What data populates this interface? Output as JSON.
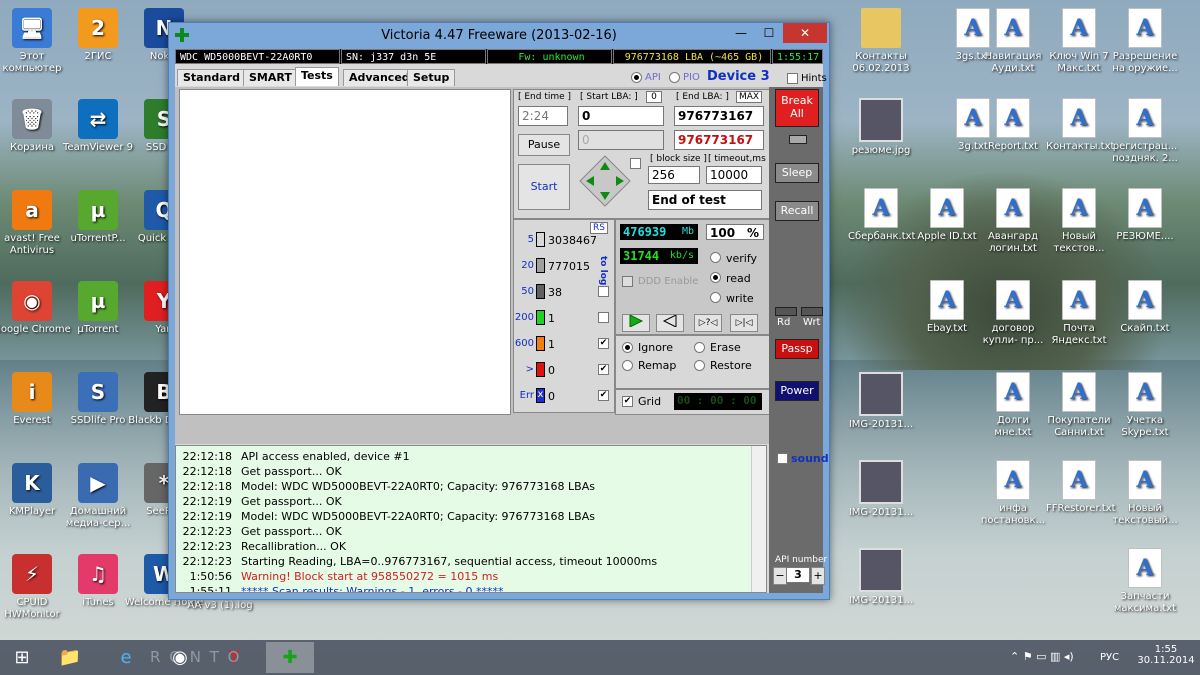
{
  "window": {
    "title": "Victoria 4.47  Freeware (2013-02-16)",
    "minimize": "—",
    "maximize": "☐",
    "close": "✕"
  },
  "infobar": {
    "model": "WDC WD5000BEVT-22A0RT0",
    "serial": "SN: j337   d3n 5E",
    "firmware": "Fw: unknown",
    "lba": "976773168 LBA (~465 GB)",
    "clock": "1:55:17"
  },
  "tabs": [
    "Standard",
    "SMART",
    "Tests",
    "Advanced",
    "Setup"
  ],
  "interface": {
    "api": "API",
    "pio": "PIO",
    "device": "Device 3",
    "hints": "Hints"
  },
  "test": {
    "end_time_label": "[ End time ]",
    "end_time_value": "2:24",
    "start_lba_label": "[ Start LBA: ]",
    "start_lba_small": "0",
    "start_lba_value": "0",
    "end_lba_label": "[ End LBA: ]",
    "end_lba_max": "MAX",
    "end_lba_value": "976773167",
    "current_lba_value": "0",
    "end_lba_value2": "976773167",
    "pause": "Pause",
    "start": "Start",
    "block_size_label": "[ block size ]",
    "block_size_value": "256",
    "timeout_label": "[ timeout,ms ]",
    "timeout_value": "10000",
    "end_action": "End of test"
  },
  "stats": {
    "rs": "RS",
    "to_log": "to log:",
    "rows": [
      {
        "label": "5",
        "color": "#d8d8d8",
        "count": "3038467",
        "checked": ""
      },
      {
        "label": "20",
        "color": "#a0a0a0",
        "count": "777015",
        "checked": ""
      },
      {
        "label": "50",
        "color": "#606060",
        "count": "38",
        "checked": ""
      },
      {
        "label": "200",
        "color": "#1fd41f",
        "count": "1",
        "checked": ""
      },
      {
        "label": "600",
        "color": "#f07f10",
        "count": "1",
        "checked": "✔"
      },
      {
        "label": ">",
        "color": "#e01010",
        "count": "0",
        "checked": "✔"
      },
      {
        "label": "Err",
        "color": "#2030d0",
        "count": "0",
        "checked": "✔"
      }
    ],
    "err_mark": "x"
  },
  "progress": {
    "mb_value": "476939",
    "mb_unit": "Mb",
    "percent": "100",
    "percent_unit": "%",
    "speed_value": "31744",
    "speed_unit": "kb/s",
    "ddd_enable": "DDD Enable",
    "verify": "verify",
    "read": "read",
    "write": "write"
  },
  "mode": {
    "ignore": "Ignore",
    "erase": "Erase",
    "remap": "Remap",
    "restore": "Restore",
    "grid": "Grid",
    "timer": "00 : 00 : 00"
  },
  "right": {
    "break": "Break All",
    "sleep": "Sleep",
    "recall": "Recall",
    "rd": "Rd",
    "wrt": "Wrt",
    "passp": "Passp",
    "power": "Power",
    "sound": "sound",
    "api_number": "API number",
    "api_value": "3",
    "minus": "−",
    "plus": "+"
  },
  "log": [
    {
      "time": "22:12:18",
      "text": "API access enabled, device #1",
      "color": "#000000"
    },
    {
      "time": "22:12:18",
      "text": "Get passport... OK",
      "color": "#000000"
    },
    {
      "time": "22:12:18",
      "text": "Model: WDC WD5000BEVT-22A0RT0; Capacity: 976773168 LBAs",
      "color": "#000000"
    },
    {
      "time": "22:12:19",
      "text": "Get passport... OK",
      "color": "#000000"
    },
    {
      "time": "22:12:19",
      "text": "Model: WDC WD5000BEVT-22A0RT0; Capacity: 976773168 LBAs",
      "color": "#000000"
    },
    {
      "time": "22:12:23",
      "text": "Get passport... OK",
      "color": "#000000"
    },
    {
      "time": "22:12:23",
      "text": "Recallibration... OK",
      "color": "#000000"
    },
    {
      "time": "22:12:23",
      "text": "Starting Reading, LBA=0..976773167, sequential access, timeout 10000ms",
      "color": "#000000"
    },
    {
      "time": "1:50:56",
      "text": "Warning! Block start at 958550272 = 1015 ms",
      "color": "#d02020"
    },
    {
      "time": "1:55:11",
      "text": "***** Scan results: Warnings - 1, errors - 0 *****",
      "color": "#1030c0"
    }
  ],
  "desktop": {
    "left_icons": [
      {
        "label": "Этот компьютер",
        "glyph": "🖥",
        "color": "#3a7bd5"
      },
      {
        "label": "2ГИС",
        "glyph": "2",
        "color": "#f29a1e"
      },
      {
        "label": "Nokia",
        "glyph": "N",
        "color": "#1a4b9c"
      },
      {
        "label": "Корзина",
        "glyph": "🗑",
        "color": "#7f8c97"
      },
      {
        "label": "TeamViewer 9",
        "glyph": "⇄",
        "color": "#0e6fbe"
      },
      {
        "label": "SSD Tw",
        "glyph": "S",
        "color": "#2d7d2d"
      },
      {
        "label": "avast! Free Antivirus",
        "glyph": "a",
        "color": "#f07a10"
      },
      {
        "label": "uTorrentP...",
        "glyph": "µ",
        "color": "#56a82f"
      },
      {
        "label": "Quick Play",
        "glyph": "Q",
        "color": "#1e5aa8"
      },
      {
        "label": "Google Chrome",
        "glyph": "◉",
        "color": "#de4433"
      },
      {
        "label": "µTorrent",
        "glyph": "µ",
        "color": "#56a82f"
      },
      {
        "label": "Yan",
        "glyph": "Y",
        "color": "#e02020"
      },
      {
        "label": "Everest",
        "glyph": "i",
        "color": "#e88a1a"
      },
      {
        "label": "SSDlife Pro",
        "glyph": "S",
        "color": "#3b6fb8"
      },
      {
        "label": "Blackb Deskto",
        "glyph": "B",
        "color": "#222222"
      },
      {
        "label": "KMPlayer",
        "glyph": "K",
        "color": "#2a5d9a"
      },
      {
        "label": "Домашний медиа-сер...",
        "glyph": "▶",
        "color": "#3a6ab0"
      },
      {
        "label": "SeePas",
        "glyph": "*",
        "color": "#666666"
      },
      {
        "label": "CPUID HWMonitor",
        "glyph": "⚡",
        "color": "#c83030"
      },
      {
        "label": "iTunes",
        "glyph": "♫",
        "color": "#e33a6a"
      },
      {
        "label": "Welcome Home",
        "glyph": "W",
        "color": "#1e5aa8"
      }
    ],
    "misc_label": "AA v3 (1).log",
    "right_icons": [
      {
        "label": "Контакты 06.02.2013",
        "type": "folder"
      },
      {
        "label": "3gs.txt",
        "type": "txt"
      },
      {
        "label": "Навигация Ауди.txt",
        "type": "txt"
      },
      {
        "label": "Ключ Win 7 Макс.txt",
        "type": "txt"
      },
      {
        "label": "Разрешение на оружие...",
        "type": "txt"
      },
      {
        "label": "резюме.jpg",
        "type": "img"
      },
      {
        "label": "3g.txt",
        "type": "txt"
      },
      {
        "label": "Report.txt",
        "type": "txt"
      },
      {
        "label": "Контакты.txt",
        "type": "txt"
      },
      {
        "label": "регистрац... поздняк. 2...",
        "type": "txt"
      },
      {
        "label": "Сбербанк.txt",
        "type": "txt"
      },
      {
        "label": "Apple ID.txt",
        "type": "txt"
      },
      {
        "label": "Авангард логин.txt",
        "type": "txt"
      },
      {
        "label": "Новый текстов...",
        "type": "txt"
      },
      {
        "label": "РЕЗЮМЕ....",
        "type": "txt"
      },
      {
        "label": "Ebay.txt",
        "type": "txt"
      },
      {
        "label": "договор купли- пр...",
        "type": "txt"
      },
      {
        "label": "Почта Яндекс.txt",
        "type": "txt"
      },
      {
        "label": "Скайп.txt",
        "type": "txt"
      },
      {
        "label": "IMG-20131...",
        "type": "img"
      },
      {
        "label": "Долги мне.txt",
        "type": "txt"
      },
      {
        "label": "Покупатели Санни.txt",
        "type": "txt"
      },
      {
        "label": "Учетка Skype.txt",
        "type": "txt"
      },
      {
        "label": "IMG-20131...",
        "type": "img"
      },
      {
        "label": "инфа постановк...",
        "type": "txt"
      },
      {
        "label": "FFRestorer.txt",
        "type": "txt"
      },
      {
        "label": "Новый текстовый...",
        "type": "txt"
      },
      {
        "label": "IMG-20131...",
        "type": "img"
      },
      {
        "label": "Запчасти максима.txt",
        "type": "txt"
      }
    ]
  },
  "taskbar": {
    "start": "⊞",
    "apps": [
      "📁",
      "e",
      "◉",
      "Y",
      "✚"
    ],
    "ghost": "R O N T O",
    "lang": "РУС",
    "time": "1:55",
    "date": "30.11.2014",
    "tray": "⌃ ⚑ ▭ ▥ ◂)"
  }
}
